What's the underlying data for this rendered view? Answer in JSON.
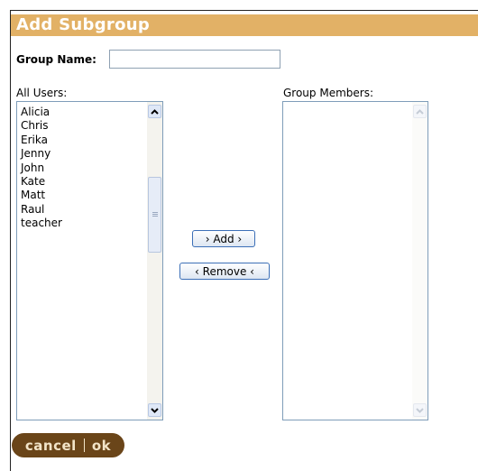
{
  "dialog": {
    "title": "Add Subgroup"
  },
  "form": {
    "group_name_label": "Group Name:",
    "group_name_value": ""
  },
  "all_users": {
    "label": "All Users:",
    "items": [
      "Alicia",
      "Chris",
      "Erika",
      "Jenny",
      "John",
      "Kate",
      "Matt",
      "Raul",
      "teacher"
    ]
  },
  "group_members": {
    "label": "Group Members:",
    "items": []
  },
  "buttons": {
    "add": "› Add ›",
    "remove": "‹ Remove ‹",
    "cancel": "cancel",
    "ok": "ok"
  },
  "colors": {
    "title_bar": "#e2b166",
    "footer_pill": "#6a4519",
    "button_border": "#3c6fb7"
  },
  "icons": [
    "scroll-up-arrow-icon",
    "scroll-down-arrow-icon",
    "scroll-grip-icon"
  ]
}
